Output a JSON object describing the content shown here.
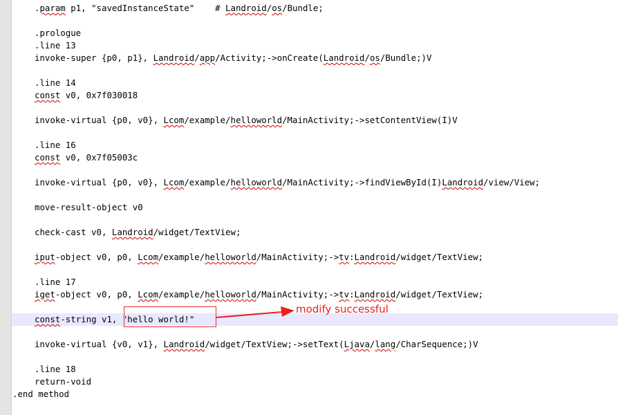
{
  "annotation": {
    "text": "modify successful",
    "color": "#e82020"
  },
  "code": {
    "l01": {
      "a": ".",
      "b": "param",
      "c": " p1, \"savedInstanceState\"    # ",
      "d": "Landroid",
      "e": "/",
      "f": "os",
      "g": "/Bundle;"
    },
    "l02": ".prologue",
    "l03": ".line 13",
    "l04": {
      "a": "invoke-super {p0, p1}, ",
      "b": "Landroid",
      "c": "/",
      "d": "app",
      "e": "/Activity;->onCreate(",
      "f": "Landroid",
      "g": "/",
      "h": "os",
      "i": "/Bundle;)V"
    },
    "l05": ".line 14",
    "l06": {
      "a": "const",
      "b": " v0, 0x7f030018"
    },
    "l07": {
      "a": "invoke-virtual {p0, v0}, ",
      "b": "Lcom",
      "c": "/example/",
      "d": "helloworld",
      "e": "/MainActivity;->setContentView(I)V"
    },
    "l08": ".line 16",
    "l09": {
      "a": "const",
      "b": " v0, 0x7f05003c"
    },
    "l10": {
      "a": "invoke-virtual {p0, v0}, ",
      "b": "Lcom",
      "c": "/example/",
      "d": "helloworld",
      "e": "/MainActivity;->findViewById(I)",
      "f": "Landroid",
      "g": "/view/View;"
    },
    "l11": "move-result-object v0",
    "l12": {
      "a": "check-cast v0, ",
      "b": "Landroid",
      "c": "/widget/TextView;"
    },
    "l13": {
      "a": "iput",
      "b": "-object v0, p0, ",
      "c": "Lcom",
      "d": "/example/",
      "e": "helloworld",
      "f": "/MainActivity;->",
      "g": "tv",
      "h": ":",
      "i": "Landroid",
      "j": "/widget/TextView;"
    },
    "l14": ".line 17",
    "l15": {
      "a": "iget",
      "b": "-object v0, p0, ",
      "c": "Lcom",
      "d": "/example/",
      "e": "helloworld",
      "f": "/MainActivity;->",
      "g": "tv",
      "h": ":",
      "i": "Landroid",
      "j": "/widget/TextView;"
    },
    "l16": {
      "a": "const",
      "b": "-string v1, ",
      "c": "\"hello world!\""
    },
    "l17": {
      "a": "invoke-virtual {v0, v1}, ",
      "b": "Landroid",
      "c": "/widget/TextView;->setText(",
      "d": "Ljava",
      "e": "/",
      "f": "lang",
      "g": "/CharSequence;)V"
    },
    "l18": ".line 18",
    "l19": "return-void",
    "l20": ".end method"
  }
}
